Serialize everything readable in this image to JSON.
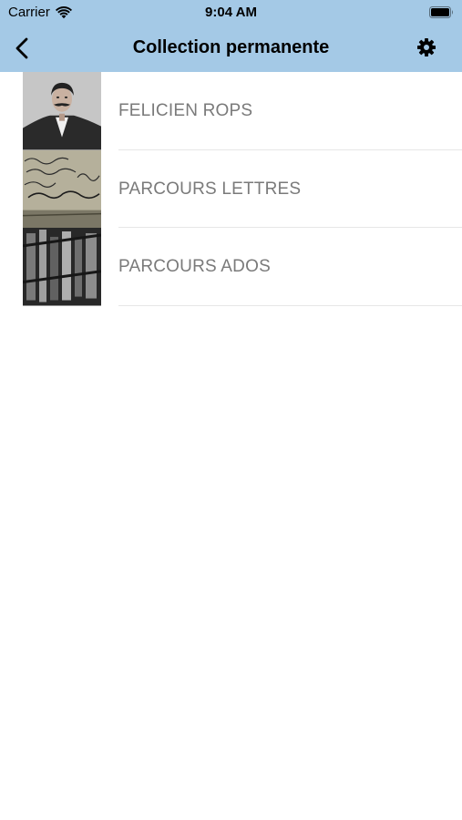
{
  "status_bar": {
    "carrier": "Carrier",
    "time": "9:04 AM",
    "wifi_icon": "wifi-icon",
    "battery_icon": "battery-icon"
  },
  "nav": {
    "title": "Collection permanente",
    "back_icon": "chevron-left-icon",
    "settings_icon": "gear-icon",
    "background_color": "#a4c9e6"
  },
  "list": {
    "items": [
      {
        "label": "FELICIEN ROPS",
        "thumbnail": "portrait-photo"
      },
      {
        "label": "PARCOURS LETTRES",
        "thumbnail": "handwritten-letter-photo"
      },
      {
        "label": "PARCOURS ADOS",
        "thumbnail": "grayscale-artwork-photo"
      }
    ],
    "label_color": "#7a7a7a"
  }
}
